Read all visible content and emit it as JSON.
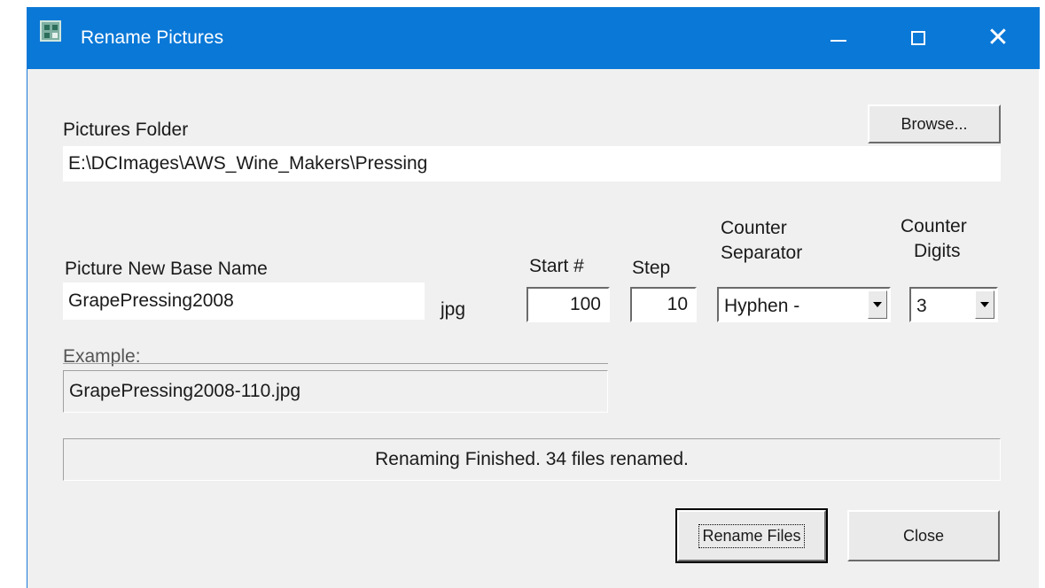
{
  "window": {
    "title": "Rename Pictures",
    "controls": {
      "minimize": "—",
      "maximize": "☐",
      "close": "✕"
    }
  },
  "folder": {
    "label": "Pictures Folder",
    "value": "E:\\DCImages\\AWS_Wine_Makers\\Pressing",
    "browse_label": "Browse..."
  },
  "base_name": {
    "label": "Picture New Base Name",
    "value": "GrapePressing2008",
    "extension": "jpg"
  },
  "start": {
    "label": "Start #",
    "value": "100"
  },
  "step": {
    "label": "Step",
    "value": "10"
  },
  "separator": {
    "label_line1": "Counter",
    "label_line2": "Separator",
    "selected": "Hyphen -"
  },
  "digits": {
    "label_line1": "Counter",
    "label_line2": "Digits",
    "selected": "3"
  },
  "example": {
    "label": "Example:",
    "value": "GrapePressing2008-110.jpg"
  },
  "status": {
    "text": "Renaming Finished. 34 files renamed."
  },
  "actions": {
    "rename_label": "Rename Files",
    "close_label": "Close"
  },
  "colors": {
    "titlebar": "#0a78d7",
    "dialog_bg": "#f0f0f0"
  },
  "icons": {
    "app": "picture-grid-icon"
  }
}
